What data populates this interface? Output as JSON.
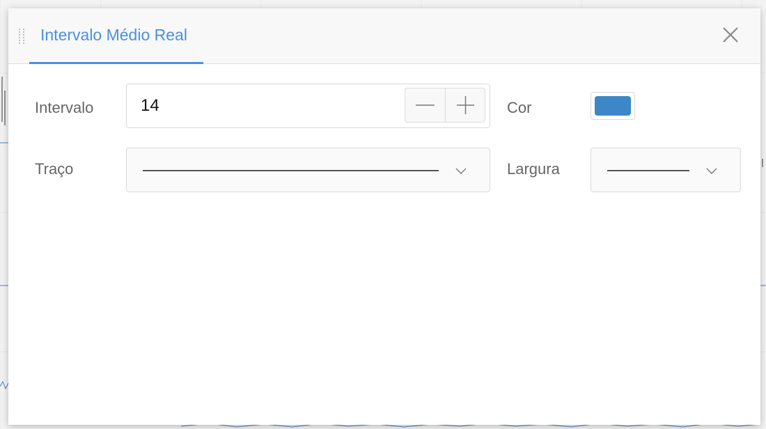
{
  "dialog": {
    "title": "Intervalo Médio Real",
    "close_icon": "close-icon",
    "drag_icon": "drag-handle-icon"
  },
  "fields": {
    "interval": {
      "label": "Intervalo",
      "value": "14",
      "decrement_icon": "minus-icon",
      "increment_icon": "plus-icon"
    },
    "color": {
      "label": "Cor",
      "value": "#3d87c8"
    },
    "stroke": {
      "label": "Traço",
      "value_icon": "solid-line-icon",
      "dropdown_icon": "chevron-down-icon"
    },
    "width": {
      "label": "Largura",
      "value_icon": "solid-line-icon",
      "dropdown_icon": "chevron-down-icon"
    }
  },
  "colors": {
    "accent": "#4a90e2",
    "label": "#666666",
    "border": "#d9d9d9"
  }
}
